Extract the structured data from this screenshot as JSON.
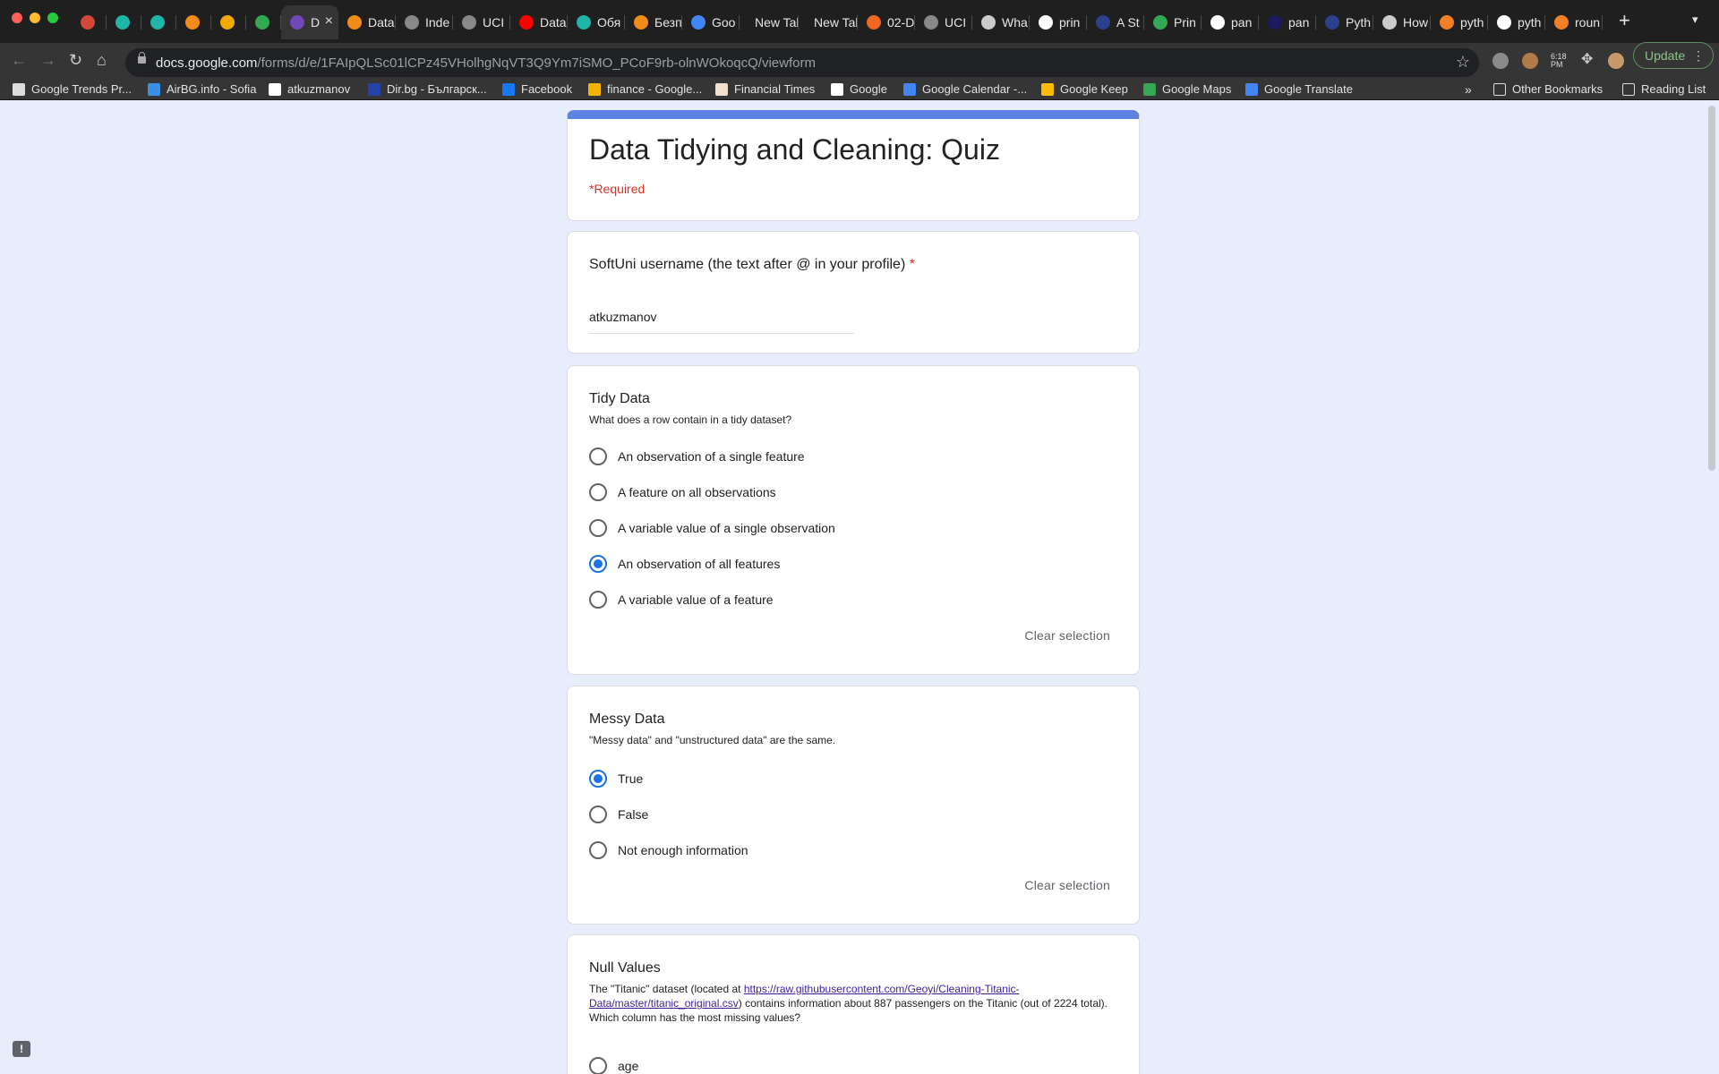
{
  "browser": {
    "tabs": [
      {
        "title": "",
        "color": "#d44638"
      },
      {
        "title": "",
        "color": "#1fb5a8"
      },
      {
        "title": "",
        "color": "#1fb5a8"
      },
      {
        "title": "",
        "color": "#f28c18"
      },
      {
        "title": "",
        "color": "#f2a900"
      },
      {
        "title": "",
        "color": "#33a853"
      },
      {
        "title": "D",
        "color": "#7248b9",
        "active": true
      },
      {
        "title": "Data",
        "color": "#f28c18"
      },
      {
        "title": "Inde",
        "color": "#888888"
      },
      {
        "title": "UCI",
        "color": "#888888"
      },
      {
        "title": "Data",
        "color": "#ff0000"
      },
      {
        "title": "Обя",
        "color": "#1fb5a8"
      },
      {
        "title": "Безп",
        "color": "#f28c18"
      },
      {
        "title": "Goo",
        "color": "#4285f4"
      },
      {
        "title": "New Tab",
        "color": ""
      },
      {
        "title": "New Tab",
        "color": ""
      },
      {
        "title": "02-D",
        "color": "#f26522"
      },
      {
        "title": "UCI",
        "color": "#888888"
      },
      {
        "title": "Wha",
        "color": "#cccccc"
      },
      {
        "title": "prin",
        "color": "#ffffff"
      },
      {
        "title": "A St",
        "color": "#2d3f8f"
      },
      {
        "title": "Prin",
        "color": "#34a853"
      },
      {
        "title": "pan",
        "color": "#ffffff"
      },
      {
        "title": "pan",
        "color": "#1a1a5e"
      },
      {
        "title": "Pyth",
        "color": "#2d3f8f"
      },
      {
        "title": "How",
        "color": "#cccccc"
      },
      {
        "title": "pyth",
        "color": "#f48024"
      },
      {
        "title": "pyth",
        "color": "#ffffff"
      },
      {
        "title": "roun",
        "color": "#f48024"
      }
    ],
    "new_tab_icon": "plus-icon",
    "url_host": "docs.google.com",
    "url_path": "/forms/d/e/1FAIpQLSc01lCPz45VHolhgNqVT3Q9Ym7iSMO_PCoF9rb-olnWOkoqcQ/viewform",
    "extension_clock_label": "6:18 PM",
    "update_label": "Update",
    "bookmarks": [
      {
        "label": "Google Trends Pr...",
        "color": "#dddddd"
      },
      {
        "label": "AirBG.info - Sofia",
        "color": "#3a8ee6"
      },
      {
        "label": "atkuzmanov",
        "color": "#ffffff"
      },
      {
        "label": "Dir.bg - Българск...",
        "color": "#2244aa"
      },
      {
        "label": "Facebook",
        "color": "#1877f2"
      },
      {
        "label": "finance - Google...",
        "color": "#f4b400"
      },
      {
        "label": "Financial Times",
        "color": "#f2dfce"
      },
      {
        "label": "Google",
        "color": "#ffffff"
      },
      {
        "label": "Google Calendar -...",
        "color": "#4285f4"
      },
      {
        "label": "Google Keep",
        "color": "#fbbc04"
      },
      {
        "label": "Google Maps",
        "color": "#34a853"
      },
      {
        "label": "Google Translate",
        "color": "#4285f4"
      }
    ],
    "other_bookmarks": "Other Bookmarks",
    "reading_list": "Reading List"
  },
  "form": {
    "title": "Data Tidying and Cleaning: Quiz",
    "required_note": "*Required",
    "accent_color": "#5f83e2",
    "username": {
      "label": "SoftUni username (the text after @ in your profile)",
      "required_mark": "*",
      "value": "atkuzmanov"
    },
    "q1": {
      "title": "Tidy Data",
      "desc": "What does a row contain in a tidy dataset?",
      "options": [
        "An observation of a single feature",
        "A feature on all observations",
        "A variable value of a single observation",
        "An observation of all features",
        "A variable value of a feature"
      ],
      "selected_index": 3,
      "clear": "Clear selection"
    },
    "q2": {
      "title": "Messy Data",
      "desc": "\"Messy data\" and \"unstructured data\" are the same.",
      "options": [
        "True",
        "False",
        "Not enough information"
      ],
      "selected_index": 0,
      "clear": "Clear selection"
    },
    "q3": {
      "title": "Null Values",
      "desc_before": "The \"Titanic\" dataset (located at ",
      "desc_link": "https://raw.githubusercontent.com/Geoyi/Cleaning-Titanic-Data/master/titanic_original.csv",
      "desc_after": ") contains information about 887 passengers on the Titanic (out of 2224 total). Which column has the most missing values?",
      "options": [
        "age"
      ]
    }
  }
}
